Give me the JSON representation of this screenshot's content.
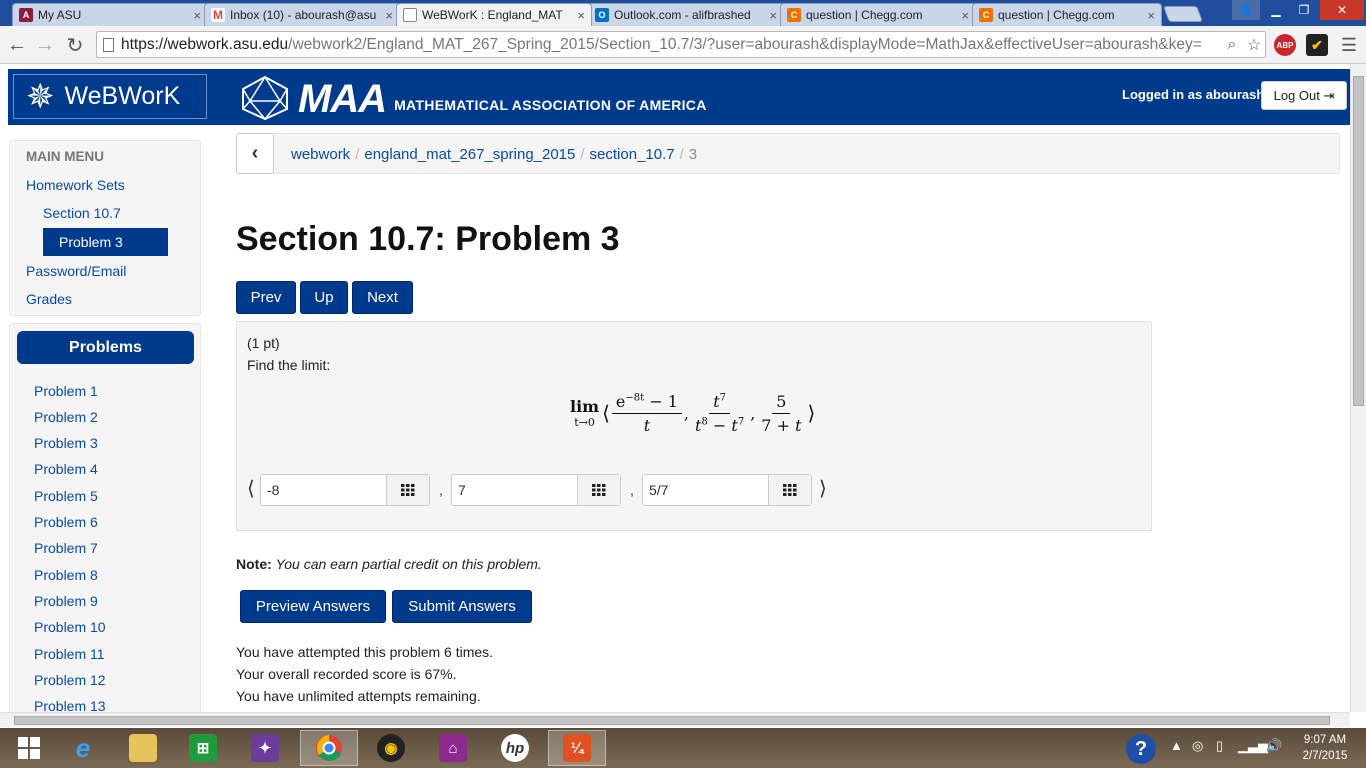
{
  "browser": {
    "tabs": [
      {
        "title": "My ASU",
        "favicon": "asu-icon",
        "color": "#8c1d40"
      },
      {
        "title": "Inbox (10) - abourash@asu",
        "favicon": "gmail-icon",
        "color": "#d44638"
      },
      {
        "title": "WeBWorK : England_MAT",
        "favicon": "page-icon",
        "color": "#888888",
        "active": true
      },
      {
        "title": "Outlook.com - alifbrashed",
        "favicon": "outlook-icon",
        "color": "#0072c6"
      },
      {
        "title": "question | Chegg.com",
        "favicon": "chegg-icon",
        "color": "#eb7100"
      },
      {
        "title": "question | Chegg.com",
        "favicon": "chegg-icon",
        "color": "#eb7100"
      }
    ],
    "url_host": "https://webwork.asu.edu",
    "url_rest": "/webwork2/England_MAT_267_Spring_2015/Section_10.7/3/?user=abourash&displayMode=MathJax&effectiveUser=abourash&key="
  },
  "header": {
    "logo": "WeBWorK",
    "maa_big": "MAA",
    "maa_small": "MATHEMATICAL ASSOCIATION OF AMERICA",
    "logged_in": "Logged in as abourash.",
    "logout": "Log Out"
  },
  "sidebar": {
    "main_menu_title": "MAIN MENU",
    "homework_sets": "Homework Sets",
    "section": "Section 10.7",
    "problem": "Problem 3",
    "password_email": "Password/Email",
    "grades": "Grades",
    "problems_title": "Problems",
    "problems": [
      "Problem 1",
      "Problem 2",
      "Problem 3",
      "Problem 4",
      "Problem 5",
      "Problem 6",
      "Problem 7",
      "Problem 8",
      "Problem 9",
      "Problem 10",
      "Problem 11",
      "Problem 12",
      "Problem 13"
    ]
  },
  "breadcrumb": {
    "items": [
      "webwork",
      "england_mat_267_spring_2015",
      "section_10.7"
    ],
    "current": "3"
  },
  "page": {
    "title": "Section 10.7: Problem 3",
    "prev": "Prev",
    "up": "Up",
    "next": "Next"
  },
  "problem": {
    "points": "(1 pt)",
    "prompt": "Find the limit:",
    "answers": [
      "-8",
      "7",
      "5/7"
    ]
  },
  "note": {
    "label": "Note:",
    "text": "You can earn partial credit on this problem."
  },
  "buttons": {
    "preview": "Preview Answers",
    "submit": "Submit Answers"
  },
  "status": {
    "attempts": "You have attempted this problem 6 times.",
    "score": "Your overall recorded score is 67%.",
    "remaining": "You have unlimited attempts remaining."
  },
  "taskbar": {
    "time": "9:07 AM",
    "date": "2/7/2015"
  },
  "colors": {
    "brand": "#003a8c",
    "link": "#0a4aa8"
  }
}
